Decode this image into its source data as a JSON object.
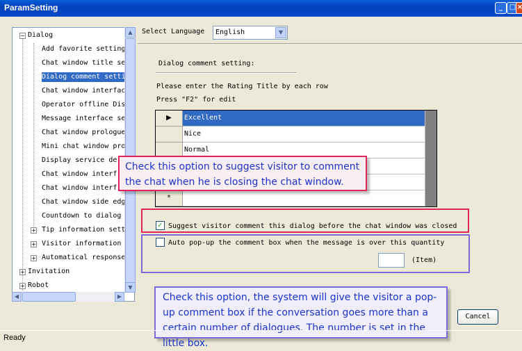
{
  "window": {
    "title": "ParamSetting"
  },
  "tree": {
    "nodes": [
      {
        "label": "Dialog",
        "expander": "−"
      },
      {
        "label": "Add favorite setting"
      },
      {
        "label": "Chat window title se"
      },
      {
        "label": "Dialog comment setti",
        "selected": true
      },
      {
        "label": "Chat window interfac"
      },
      {
        "label": "Operator offline Dis"
      },
      {
        "label": "Message interface se"
      },
      {
        "label": "Chat window prologue"
      },
      {
        "label": "Mini chat window pro"
      },
      {
        "label": "Display service de"
      },
      {
        "label": "Chat window interf"
      },
      {
        "label": "Chat window interf"
      },
      {
        "label": "Chat window side edg"
      },
      {
        "label": "Countdown to dialog"
      },
      {
        "label": "Tip information sett",
        "expander": "+"
      },
      {
        "label": "Visitor information",
        "expander": "+"
      },
      {
        "label": "Automatical response",
        "expander": "+"
      },
      {
        "label": "Invitation",
        "expander": "+"
      },
      {
        "label": "Robot",
        "expander": "+"
      }
    ]
  },
  "language": {
    "label": "Select Language",
    "value": "English"
  },
  "dialog_comment": {
    "section_label": "Dialog comment setting:",
    "instruction_1": "Please enter the Rating Title by each row",
    "instruction_2": "Press \"F2\" for edit",
    "rows": [
      {
        "marker": "▶",
        "value": "Excellent"
      },
      {
        "marker": "",
        "value": "Nice"
      },
      {
        "marker": "",
        "value": "Normal"
      },
      {
        "marker": "",
        "value": ""
      },
      {
        "marker": "",
        "value": ""
      },
      {
        "marker": "*",
        "value": ""
      }
    ]
  },
  "options": {
    "suggest_comment": {
      "label": "Suggest visitor comment this dialog before the chat window was closed",
      "checked": true
    },
    "auto_popup": {
      "label": "Auto pop-up the comment box when the message is over this quantity",
      "checked": false
    },
    "quantity_value": "",
    "item_label": "(Item)"
  },
  "callouts": {
    "checkbox_tip": "Check this option to suggest visitor to comment the chat when he is closing the chat window.",
    "popup_tip": "Check this option, the system will give the visitor a pop-up comment box if the conversation goes more than a certain number of dialogues.  The number is set in the little box."
  },
  "buttons": {
    "cancel": "Cancel"
  },
  "status": {
    "text": "Ready"
  },
  "colors": {
    "title_bar": "#0342b9",
    "selection": "#316ac5",
    "highlight_red": "#e0245a",
    "highlight_purple": "#7b6bd9",
    "callout_text": "#1a33cc"
  },
  "icons": {
    "minimize": "minimize-icon",
    "maximize": "maximize-icon",
    "close": "close-icon",
    "dropdown": "chevron-down-icon",
    "row_current": "triangle-right-icon",
    "row_new": "asterisk-icon"
  }
}
